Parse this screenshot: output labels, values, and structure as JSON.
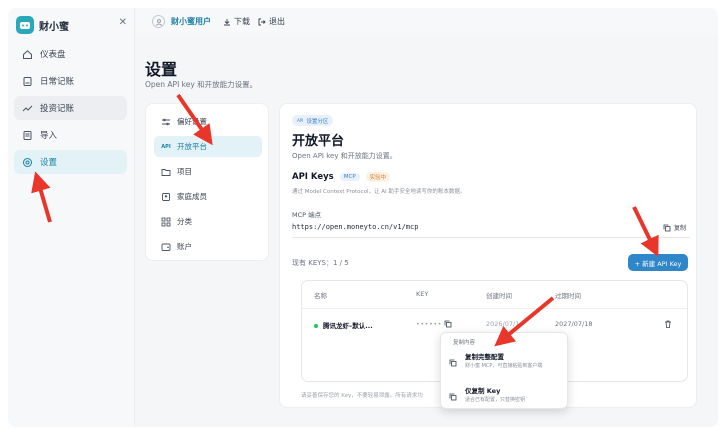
{
  "brand": {
    "name": "财小蜜"
  },
  "sidebar": {
    "items": [
      {
        "label": "仪表盘",
        "icon": "home-icon"
      },
      {
        "label": "日常记账",
        "icon": "ledger-icon"
      },
      {
        "label": "投资记账",
        "icon": "trending-icon"
      },
      {
        "label": "导入",
        "icon": "import-icon"
      },
      {
        "label": "设置",
        "icon": "gear-icon"
      }
    ]
  },
  "topbar": {
    "user": "财小蜜用户",
    "download": "下载",
    "logout": "退出"
  },
  "page": {
    "title": "设置",
    "subtitle": "Open API key 和开放能力设置。"
  },
  "settings_nav": {
    "items": [
      {
        "label": "偏好设置",
        "icon": "sliders-icon"
      },
      {
        "label": "开放平台",
        "icon": "api-icon"
      },
      {
        "label": "项目",
        "icon": "folder-icon"
      },
      {
        "label": "家庭成员",
        "icon": "member-icon"
      },
      {
        "label": "分类",
        "icon": "grid-icon"
      },
      {
        "label": "账户",
        "icon": "wallet-icon"
      }
    ]
  },
  "card": {
    "tag": "设置分区",
    "title": "开放平台",
    "subtitle": "Open API key 和开放能力设置。",
    "api_title": "API Keys",
    "badge_mcp": "MCP",
    "badge_beta": "实验中",
    "api_desc": "通过 Model Context Protocol，让 AI 助手安全地读写你的账本数据。",
    "mcp_label": "MCP 端点",
    "mcp_url": "https://open.moneyto.cn/v1/mcp",
    "copy": "复制",
    "keys_count": "现有 KEYS：1 / 5",
    "new_key": "+ 新建 API Key",
    "footnote": "请妥善保存您的 Key，不要轻易泄露。所有请求均"
  },
  "table": {
    "headers": [
      "名称",
      "KEY",
      "创建时间",
      "过期时间"
    ],
    "row": {
      "name": "腾讯龙虾–默认...",
      "key": "••••••",
      "created": "2026/07/1",
      "expires": "2027/07/18"
    }
  },
  "popover": {
    "title": "复制内容",
    "item1": {
      "label": "复制完整配置",
      "desc": "财小蜜 MCP，可直接粘贴到客户端"
    },
    "item2": {
      "label": "仅复制 Key",
      "desc": "适合已有配置，只替换密钥"
    }
  },
  "colors": {
    "accent": "#1b7fa3",
    "primary_button": "#2f86c8",
    "annotation_arrow": "#e8362a",
    "status_active": "#22c55e"
  }
}
